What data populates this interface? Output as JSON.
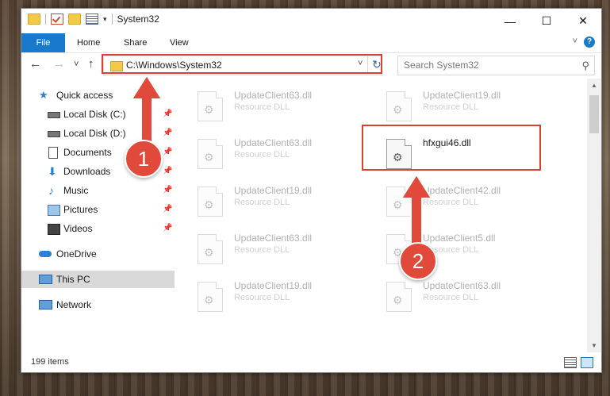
{
  "window": {
    "title": "System32",
    "minimize": "—",
    "maximize": "☐",
    "close": "✕"
  },
  "ribbon": {
    "tabs": [
      "File",
      "Home",
      "Share",
      "View"
    ],
    "help": "?"
  },
  "nav": {
    "back": "←",
    "forward": "→",
    "recent": "˅",
    "up": "↑"
  },
  "address": {
    "path": "C:\\Windows\\System32",
    "dropdown": "˅",
    "refresh": "↻"
  },
  "search": {
    "placeholder": "Search System32",
    "icon": "search-icon"
  },
  "sidebar": {
    "items": [
      {
        "label": "Quick access",
        "icon": "star-icon",
        "pinned": false
      },
      {
        "label": "Local Disk (C:)",
        "icon": "drive-icon",
        "pinned": true
      },
      {
        "label": "Local Disk (D:)",
        "icon": "drive-icon",
        "pinned": true
      },
      {
        "label": "Documents",
        "icon": "documents-icon",
        "pinned": true
      },
      {
        "label": "Downloads",
        "icon": "download-icon",
        "pinned": true
      },
      {
        "label": "Music",
        "icon": "music-icon",
        "pinned": true
      },
      {
        "label": "Pictures",
        "icon": "pictures-icon",
        "pinned": true
      },
      {
        "label": "Videos",
        "icon": "videos-icon",
        "pinned": true
      },
      {
        "label": "OneDrive",
        "icon": "cloud-icon",
        "pinned": false
      },
      {
        "label": "This PC",
        "icon": "computer-icon",
        "pinned": false,
        "selected": true
      },
      {
        "label": "Network",
        "icon": "network-icon",
        "pinned": false
      }
    ]
  },
  "files": {
    "left": [
      {
        "name": "UpdateClient63.dll",
        "type": "Resource DLL"
      },
      {
        "name": "UpdateClient63.dll",
        "type": "Resource DLL"
      },
      {
        "name": "UpdateClient19.dll",
        "type": "Resource DLL"
      },
      {
        "name": "UpdateClient63.dll",
        "type": "Resource DLL"
      },
      {
        "name": "UpdateClient19.dll",
        "type": "Resource DLL"
      }
    ],
    "right": [
      {
        "name": "UpdateClient19.dll",
        "type": "Resource DLL"
      },
      {
        "name": "hfxgui46.dll",
        "type": ""
      },
      {
        "name": "UpdateClient42.dll",
        "type": "Resource DLL"
      },
      {
        "name": "UpdateClient5.dll",
        "type": "Resource DLL"
      },
      {
        "name": "UpdateClient63.dll",
        "type": "Resource DLL"
      }
    ]
  },
  "status": {
    "item_count": "199 items"
  },
  "callouts": {
    "step1": "1",
    "step2": "2"
  },
  "colors": {
    "accent": "#1979ca",
    "highlight": "#d9403a",
    "badge": "#e14a3b"
  }
}
